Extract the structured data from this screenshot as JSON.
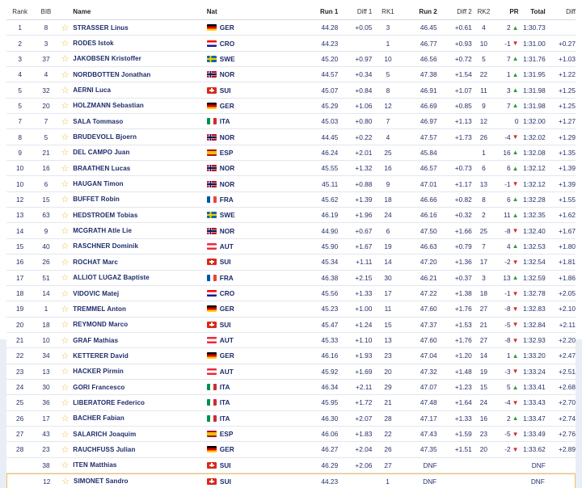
{
  "headers": {
    "rank": "Rank",
    "bib": "BIB",
    "name": "Name",
    "nat": "Nat",
    "run1": "Run 1",
    "diff1": "Diff 1",
    "rk1": "RK1",
    "run2": "Run 2",
    "diff2": "Diff 2",
    "rk2": "RK2",
    "pr": "PR",
    "total": "Total",
    "diff": "Diff"
  },
  "colors": {
    "accent_star": "#f3b730",
    "up": "#2a9d3b",
    "down": "#d42a2a",
    "selected_border": "#f0c15a"
  },
  "rows": [
    {
      "rank": "1",
      "bib": "8",
      "name": "STRASSER Linus",
      "nat": "GER",
      "run1": "44.28",
      "diff1": "+0.05",
      "rk1": "3",
      "run2": "46.45",
      "diff2": "+0.61",
      "rk2": "4",
      "pr": "2",
      "dir": "up",
      "total": "1:30.73",
      "diff": ""
    },
    {
      "rank": "2",
      "bib": "3",
      "name": "RODES Istok",
      "nat": "CRO",
      "run1": "44.23",
      "diff1": "",
      "rk1": "1",
      "run2": "46.77",
      "diff2": "+0.93",
      "rk2": "10",
      "pr": "-1",
      "dir": "down",
      "total": "1:31.00",
      "diff": "+0.27"
    },
    {
      "rank": "3",
      "bib": "37",
      "name": "JAKOBSEN Kristoffer",
      "nat": "SWE",
      "run1": "45.20",
      "diff1": "+0.97",
      "rk1": "10",
      "run2": "46.56",
      "diff2": "+0.72",
      "rk2": "5",
      "pr": "7",
      "dir": "up",
      "total": "1:31.76",
      "diff": "+1.03"
    },
    {
      "rank": "4",
      "bib": "4",
      "name": "NORDBOTTEN Jonathan",
      "nat": "NOR",
      "run1": "44.57",
      "diff1": "+0.34",
      "rk1": "5",
      "run2": "47.38",
      "diff2": "+1.54",
      "rk2": "22",
      "pr": "1",
      "dir": "up",
      "total": "1:31.95",
      "diff": "+1.22"
    },
    {
      "rank": "5",
      "bib": "32",
      "name": "AERNI Luca",
      "nat": "SUI",
      "run1": "45.07",
      "diff1": "+0.84",
      "rk1": "8",
      "run2": "46.91",
      "diff2": "+1.07",
      "rk2": "11",
      "pr": "3",
      "dir": "up",
      "total": "1:31.98",
      "diff": "+1.25"
    },
    {
      "rank": "5",
      "bib": "20",
      "name": "HOLZMANN Sebastian",
      "nat": "GER",
      "run1": "45.29",
      "diff1": "+1.06",
      "rk1": "12",
      "run2": "46.69",
      "diff2": "+0.85",
      "rk2": "9",
      "pr": "7",
      "dir": "up",
      "total": "1:31.98",
      "diff": "+1.25"
    },
    {
      "rank": "7",
      "bib": "7",
      "name": "SALA Tommaso",
      "nat": "ITA",
      "run1": "45.03",
      "diff1": "+0.80",
      "rk1": "7",
      "run2": "46.97",
      "diff2": "+1.13",
      "rk2": "12",
      "pr": "0",
      "dir": "none",
      "total": "1:32.00",
      "diff": "+1.27"
    },
    {
      "rank": "8",
      "bib": "5",
      "name": "BRUDEVOLL Bjoern",
      "nat": "NOR",
      "run1": "44.45",
      "diff1": "+0.22",
      "rk1": "4",
      "run2": "47.57",
      "diff2": "+1.73",
      "rk2": "26",
      "pr": "-4",
      "dir": "down",
      "total": "1:32.02",
      "diff": "+1.29"
    },
    {
      "rank": "9",
      "bib": "21",
      "name": "DEL CAMPO Juan",
      "nat": "ESP",
      "run1": "46.24",
      "diff1": "+2.01",
      "rk1": "25",
      "run2": "45.84",
      "diff2": "",
      "rk2": "1",
      "pr": "16",
      "dir": "up",
      "total": "1:32.08",
      "diff": "+1.35"
    },
    {
      "rank": "10",
      "bib": "16",
      "name": "BRAATHEN Lucas",
      "nat": "NOR",
      "run1": "45.55",
      "diff1": "+1.32",
      "rk1": "16",
      "run2": "46.57",
      "diff2": "+0.73",
      "rk2": "6",
      "pr": "6",
      "dir": "up",
      "total": "1:32.12",
      "diff": "+1.39"
    },
    {
      "rank": "10",
      "bib": "6",
      "name": "HAUGAN Timon",
      "nat": "NOR",
      "run1": "45.11",
      "diff1": "+0.88",
      "rk1": "9",
      "run2": "47.01",
      "diff2": "+1.17",
      "rk2": "13",
      "pr": "-1",
      "dir": "down",
      "total": "1:32.12",
      "diff": "+1.39"
    },
    {
      "rank": "12",
      "bib": "15",
      "name": "BUFFET Robin",
      "nat": "FRA",
      "run1": "45.62",
      "diff1": "+1.39",
      "rk1": "18",
      "run2": "46.66",
      "diff2": "+0.82",
      "rk2": "8",
      "pr": "6",
      "dir": "up",
      "total": "1:32.28",
      "diff": "+1.55"
    },
    {
      "rank": "13",
      "bib": "63",
      "name": "HEDSTROEM Tobias",
      "nat": "SWE",
      "run1": "46.19",
      "diff1": "+1.96",
      "rk1": "24",
      "run2": "46.16",
      "diff2": "+0.32",
      "rk2": "2",
      "pr": "11",
      "dir": "up",
      "total": "1:32.35",
      "diff": "+1.62"
    },
    {
      "rank": "14",
      "bib": "9",
      "name": "MCGRATH Atle Lie",
      "nat": "NOR",
      "run1": "44.90",
      "diff1": "+0.67",
      "rk1": "6",
      "run2": "47.50",
      "diff2": "+1.66",
      "rk2": "25",
      "pr": "-8",
      "dir": "down",
      "total": "1:32.40",
      "diff": "+1.67"
    },
    {
      "rank": "15",
      "bib": "40",
      "name": "RASCHNER Dominik",
      "nat": "AUT",
      "run1": "45.90",
      "diff1": "+1.67",
      "rk1": "19",
      "run2": "46.63",
      "diff2": "+0.79",
      "rk2": "7",
      "pr": "4",
      "dir": "up",
      "total": "1:32.53",
      "diff": "+1.80"
    },
    {
      "rank": "16",
      "bib": "26",
      "name": "ROCHAT Marc",
      "nat": "SUI",
      "run1": "45.34",
      "diff1": "+1.11",
      "rk1": "14",
      "run2": "47.20",
      "diff2": "+1.36",
      "rk2": "17",
      "pr": "-2",
      "dir": "down",
      "total": "1:32.54",
      "diff": "+1.81"
    },
    {
      "rank": "17",
      "bib": "51",
      "name": "ALLIOT LUGAZ Baptiste",
      "nat": "FRA",
      "run1": "46.38",
      "diff1": "+2.15",
      "rk1": "30",
      "run2": "46.21",
      "diff2": "+0.37",
      "rk2": "3",
      "pr": "13",
      "dir": "up",
      "total": "1:32.59",
      "diff": "+1.86"
    },
    {
      "rank": "18",
      "bib": "14",
      "name": "VIDOVIC Matej",
      "nat": "CRO",
      "run1": "45.56",
      "diff1": "+1.33",
      "rk1": "17",
      "run2": "47.22",
      "diff2": "+1.38",
      "rk2": "18",
      "pr": "-1",
      "dir": "down",
      "total": "1:32.78",
      "diff": "+2.05"
    },
    {
      "rank": "19",
      "bib": "1",
      "name": "TREMMEL Anton",
      "nat": "GER",
      "run1": "45.23",
      "diff1": "+1.00",
      "rk1": "11",
      "run2": "47.60",
      "diff2": "+1.76",
      "rk2": "27",
      "pr": "-8",
      "dir": "down",
      "total": "1:32.83",
      "diff": "+2.10"
    },
    {
      "rank": "20",
      "bib": "18",
      "name": "REYMOND Marco",
      "nat": "SUI",
      "run1": "45.47",
      "diff1": "+1.24",
      "rk1": "15",
      "run2": "47.37",
      "diff2": "+1.53",
      "rk2": "21",
      "pr": "-5",
      "dir": "down",
      "total": "1:32.84",
      "diff": "+2.11"
    },
    {
      "rank": "21",
      "bib": "10",
      "name": "GRAF Mathias",
      "nat": "AUT",
      "run1": "45.33",
      "diff1": "+1.10",
      "rk1": "13",
      "run2": "47.60",
      "diff2": "+1.76",
      "rk2": "27",
      "pr": "-8",
      "dir": "down",
      "total": "1:32.93",
      "diff": "+2.20"
    },
    {
      "rank": "22",
      "bib": "34",
      "name": "KETTERER David",
      "nat": "GER",
      "run1": "46.16",
      "diff1": "+1.93",
      "rk1": "23",
      "run2": "47.04",
      "diff2": "+1.20",
      "rk2": "14",
      "pr": "1",
      "dir": "up",
      "total": "1:33.20",
      "diff": "+2.47"
    },
    {
      "rank": "23",
      "bib": "13",
      "name": "HACKER Pirmin",
      "nat": "AUT",
      "run1": "45.92",
      "diff1": "+1.69",
      "rk1": "20",
      "run2": "47.32",
      "diff2": "+1.48",
      "rk2": "19",
      "pr": "-3",
      "dir": "down",
      "total": "1:33.24",
      "diff": "+2.51"
    },
    {
      "rank": "24",
      "bib": "30",
      "name": "GORI Francesco",
      "nat": "ITA",
      "run1": "46.34",
      "diff1": "+2.11",
      "rk1": "29",
      "run2": "47.07",
      "diff2": "+1.23",
      "rk2": "15",
      "pr": "5",
      "dir": "up",
      "total": "1:33.41",
      "diff": "+2.68"
    },
    {
      "rank": "25",
      "bib": "36",
      "name": "LIBERATORE Federico",
      "nat": "ITA",
      "run1": "45.95",
      "diff1": "+1.72",
      "rk1": "21",
      "run2": "47.48",
      "diff2": "+1.64",
      "rk2": "24",
      "pr": "-4",
      "dir": "down",
      "total": "1:33.43",
      "diff": "+2.70"
    },
    {
      "rank": "26",
      "bib": "17",
      "name": "BACHER Fabian",
      "nat": "ITA",
      "run1": "46.30",
      "diff1": "+2.07",
      "rk1": "28",
      "run2": "47.17",
      "diff2": "+1.33",
      "rk2": "16",
      "pr": "2",
      "dir": "up",
      "total": "1:33.47",
      "diff": "+2.74"
    },
    {
      "rank": "27",
      "bib": "43",
      "name": "SALARICH Joaquim",
      "nat": "ESP",
      "run1": "46.06",
      "diff1": "+1.83",
      "rk1": "22",
      "run2": "47.43",
      "diff2": "+1.59",
      "rk2": "23",
      "pr": "-5",
      "dir": "down",
      "total": "1:33.49",
      "diff": "+2.76"
    },
    {
      "rank": "28",
      "bib": "23",
      "name": "RAUCHFUSS Julian",
      "nat": "GER",
      "run1": "46.27",
      "diff1": "+2.04",
      "rk1": "26",
      "run2": "47.35",
      "diff2": "+1.51",
      "rk2": "20",
      "pr": "-2",
      "dir": "down",
      "total": "1:33.62",
      "diff": "+2.89"
    },
    {
      "rank": "",
      "bib": "38",
      "name": "ITEN Matthias",
      "nat": "SUI",
      "run1": "46.29",
      "diff1": "+2.06",
      "rk1": "27",
      "run2": "DNF",
      "diff2": "",
      "rk2": "",
      "pr": "",
      "dir": "none",
      "total": "DNF",
      "diff": ""
    },
    {
      "rank": "",
      "bib": "12",
      "name": "SIMONET Sandro",
      "nat": "SUI",
      "run1": "44.23",
      "diff1": "",
      "rk1": "1",
      "run2": "DNF",
      "diff2": "",
      "rk2": "",
      "pr": "",
      "dir": "none",
      "total": "DNF",
      "diff": ""
    }
  ]
}
